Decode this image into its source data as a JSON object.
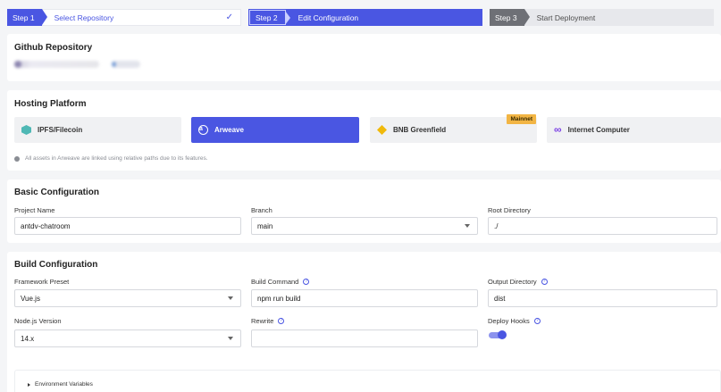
{
  "steps": [
    {
      "num": "Step 1",
      "label": "Select Repository",
      "done_icon": "check-icon"
    },
    {
      "num": "Step 2",
      "label": "Edit Configuration"
    },
    {
      "num": "Step 3",
      "label": "Start Deployment"
    }
  ],
  "repository": {
    "title": "Github Repository"
  },
  "hosting": {
    "title": "Hosting Platform",
    "platforms": [
      {
        "label": "IPFS/Filecoin",
        "icon": "ipfs-filecoin-icon"
      },
      {
        "label": "Arweave",
        "icon": "arweave-icon",
        "selected": true
      },
      {
        "label": "BNB Greenfield",
        "icon": "bnb-greenfield-icon",
        "badge": "Mainnet"
      },
      {
        "label": "Internet Computer",
        "icon": "internet-computer-icon"
      }
    ],
    "note": "All assets in Arweave are linked using relative paths due to its features."
  },
  "basic": {
    "title": "Basic Configuration",
    "project_name_label": "Project Name",
    "project_name_value": "antdv-chatroom",
    "branch_label": "Branch",
    "branch_value": "main",
    "root_label": "Root Directory",
    "root_value": "./"
  },
  "build": {
    "title": "Build Configuration",
    "framework_label": "Framework Preset",
    "framework_value": "Vue.js",
    "build_cmd_label": "Build Command",
    "build_cmd_value": "npm run build",
    "output_label": "Output Directory",
    "output_value": "dist",
    "node_label": "Node.js Version",
    "node_value": "14.x",
    "rewrite_label": "Rewrite",
    "rewrite_value": "",
    "hooks_label": "Deploy Hooks",
    "hooks_enabled": true,
    "env_label": "Environment Variables"
  },
  "colors": {
    "accent": "#4a56e2",
    "badge": "#f2b544"
  }
}
